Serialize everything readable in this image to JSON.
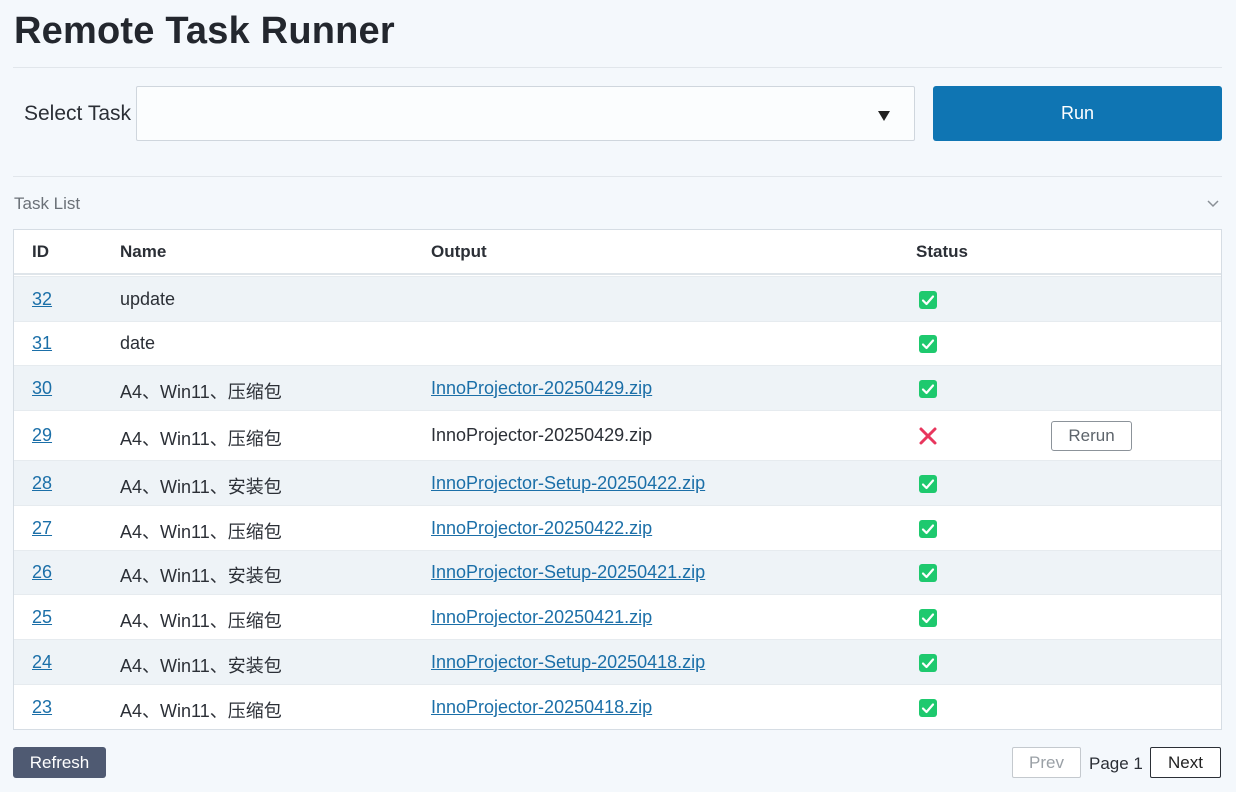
{
  "app": {
    "title": "Remote Task Runner"
  },
  "task_form": {
    "label": "Select Task",
    "selected_value": "",
    "run_label": "Run"
  },
  "task_list": {
    "title": "Task List",
    "columns": {
      "id": "ID",
      "name": "Name",
      "output": "Output",
      "status": "Status"
    },
    "rows": [
      {
        "id": "32",
        "name": "update",
        "output": "",
        "output_link": false,
        "status": "success",
        "action": ""
      },
      {
        "id": "31",
        "name": "date",
        "output": "",
        "output_link": false,
        "status": "success",
        "action": ""
      },
      {
        "id": "30",
        "name": "A4、Win11、压缩包",
        "output": "InnoProjector-20250429.zip",
        "output_link": true,
        "status": "success",
        "action": ""
      },
      {
        "id": "29",
        "name": "A4、Win11、压缩包",
        "output": "InnoProjector-20250429.zip",
        "output_link": false,
        "status": "failed",
        "action": "Rerun"
      },
      {
        "id": "28",
        "name": "A4、Win11、安装包",
        "output": "InnoProjector-Setup-20250422.zip",
        "output_link": true,
        "status": "success",
        "action": ""
      },
      {
        "id": "27",
        "name": "A4、Win11、压缩包",
        "output": "InnoProjector-20250422.zip",
        "output_link": true,
        "status": "success",
        "action": ""
      },
      {
        "id": "26",
        "name": "A4、Win11、安装包",
        "output": "InnoProjector-Setup-20250421.zip",
        "output_link": true,
        "status": "success",
        "action": ""
      },
      {
        "id": "25",
        "name": "A4、Win11、压缩包",
        "output": "InnoProjector-20250421.zip",
        "output_link": true,
        "status": "success",
        "action": ""
      },
      {
        "id": "24",
        "name": "A4、Win11、安装包",
        "output": "InnoProjector-Setup-20250418.zip",
        "output_link": true,
        "status": "success",
        "action": ""
      },
      {
        "id": "23",
        "name": "A4、Win11、压缩包",
        "output": "InnoProjector-20250418.zip",
        "output_link": true,
        "status": "success",
        "action": ""
      }
    ]
  },
  "footer": {
    "refresh_label": "Refresh",
    "prev_label": "Prev",
    "page_label": "Page 1",
    "next_label": "Next"
  },
  "colors": {
    "accent": "#0f75b3",
    "success": "#1ec96e",
    "failure": "#e8365d",
    "refresh_bg": "#4f5a72"
  },
  "icons": {
    "select_arrow": "caret-down-icon",
    "collapse": "chevron-down-icon",
    "success": "check-square-icon",
    "failure": "x-icon"
  }
}
